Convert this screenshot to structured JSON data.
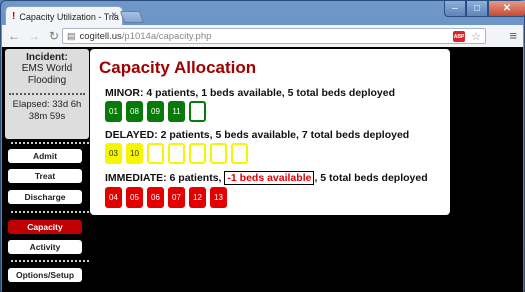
{
  "browser": {
    "tab_title": "Capacity Utilization - Tria",
    "tab_favicon": "!",
    "url_host": "cogitell.us",
    "url_path": "/p1014a/capacity.php"
  },
  "incident": {
    "label": "Incident:",
    "name_line1": "EMS World",
    "name_line2": "Flooding",
    "elapsed_line1": "Elapsed: 33d 6h",
    "elapsed_line2": "38m 59s"
  },
  "nav": {
    "items": [
      {
        "label": "Admit"
      },
      {
        "label": "Treat"
      },
      {
        "label": "Discharge"
      },
      {
        "label": "Capacity",
        "active": true
      },
      {
        "label": "Activity"
      },
      {
        "label": "Options/Setup"
      }
    ]
  },
  "main": {
    "title": "Capacity Allocation",
    "minor": {
      "text": "MINOR: 4 patients, 1 beds available, 5 total beds deployed",
      "beds": [
        "01",
        "08",
        "09",
        "11",
        ""
      ]
    },
    "delayed": {
      "text": "DELAYED: 2 patients, 5 beds available, 7 total beds deployed",
      "beds": [
        "03",
        "10",
        "",
        "",
        "",
        "",
        ""
      ]
    },
    "immediate": {
      "prefix": "IMMEDIATE: 6 patients,",
      "alert": "-1 beds available",
      "suffix": ", 5 total beds deployed",
      "beds": [
        "04",
        "05",
        "06",
        "07",
        "12",
        "13"
      ]
    }
  },
  "colors": {
    "accent_red": "#a00000",
    "minor_green": "#087a08",
    "delayed_yellow": "#f6f600",
    "immediate_red": "#e50000",
    "active_nav": "#c00000"
  }
}
